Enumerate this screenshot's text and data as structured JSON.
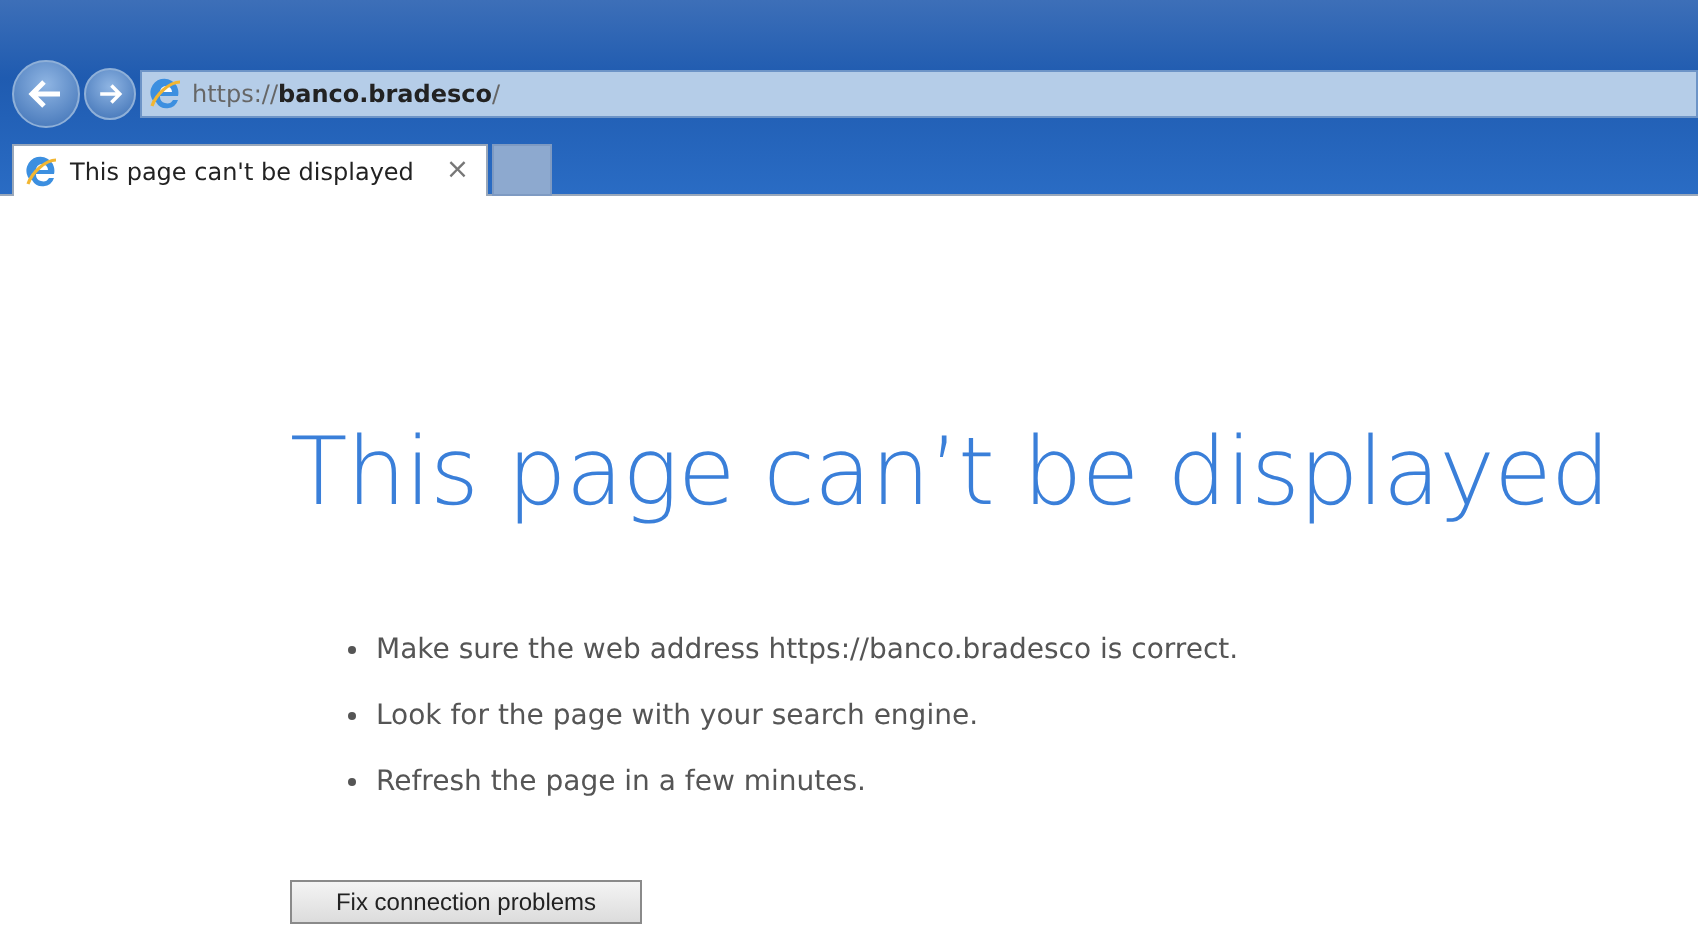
{
  "browser": {
    "address": "https://**banco.bradesco**/",
    "tabs": [
      {
        "label": "This page can't be displayed",
        "close": "×",
        "selected": true
      }
    ]
  },
  "page": {
    "heading": "This page can’t be displayed",
    "suggestions": [
      "Make sure the web address https://banco.bradesco is correct.",
      "Look for the page with your search engine.",
      "Refresh the page in a few minutes."
    ],
    "button": "Fix connection problems"
  }
}
